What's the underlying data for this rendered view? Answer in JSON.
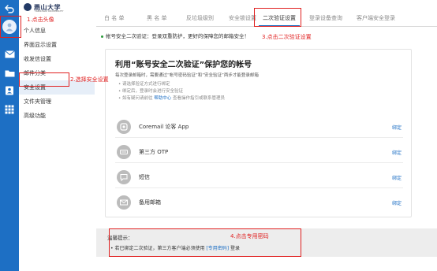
{
  "colors": {
    "rail": "#1d6fc4",
    "accent": "#1d6fc4",
    "annotation": "#e02020",
    "success": "#2a9a3a"
  },
  "logo": {
    "text": "燕山大学",
    "subtitle": "YANSHAN UNIVERSITY"
  },
  "rail_icons": [
    "back-icon",
    "avatar-icon",
    "mail-icon",
    "folder-icon",
    "contacts-icon",
    "apps-icon"
  ],
  "nav": {
    "items": [
      "个人信息",
      "界面显示设置",
      "收发信设置",
      "邮件分类",
      "安全设置",
      "文件夹管理",
      "高级功能"
    ]
  },
  "tabs": [
    "白 名 单",
    "黑 名 单",
    "反垃圾级别",
    "安全锁设置",
    "二次验证设置",
    "登录设备查询",
    "客户端安全登录"
  ],
  "notice": "帐号安全二次验证：登录双重防护，更好的保障您的邮箱安全！",
  "card": {
    "title": "利用“账号安全二次验证”保护您的帐号",
    "desc": "每次登录邮箱时，需要通过“帐号密码验证”和“安全验证”两步才能登录邮箱",
    "tips": [
      "请选择验证方式进行绑定",
      "绑定后，登录时会进行安全验证"
    ],
    "tip_help_prefix": "如有疑问请前往",
    "tip_help_link": "帮助中心",
    "tip_help_suffix": "查看操作指引或联系管理员",
    "methods": [
      {
        "label": "Coremail 论客 App",
        "action": "绑定",
        "icon": "app-icon"
      },
      {
        "label": "第三方 OTP",
        "action": "绑定",
        "icon": "otp-icon"
      },
      {
        "label": "短信",
        "action": "绑定",
        "icon": "sms-icon"
      },
      {
        "label": "备用邮箱",
        "action": "绑定",
        "icon": "mailbox-icon"
      }
    ]
  },
  "warm_tip": {
    "title": "温馨提示：",
    "text_prefix": "若已绑定二次验证，第三方客户端必须使用",
    "link": "[专用密码]",
    "text_suffix": "登录"
  },
  "annotations": [
    "1.点击头像",
    "2.选择安全设置",
    "3.点击二次验证设置",
    "4.点击专用密码"
  ]
}
